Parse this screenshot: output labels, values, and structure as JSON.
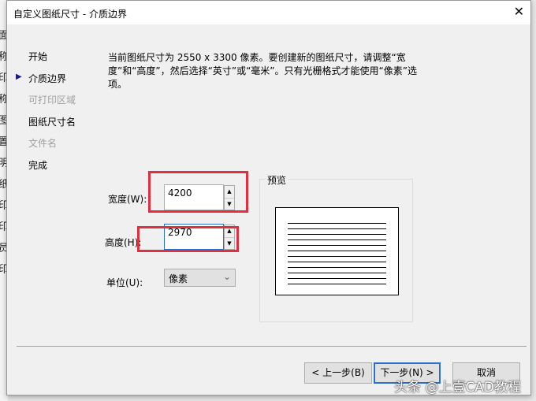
{
  "background_fragments": [
    "面",
    "称",
    "印",
    "称",
    "图",
    "置",
    "明",
    "纸",
    "印",
    "印",
    "员",
    "印"
  ],
  "dialog": {
    "title": "自定义图纸尺寸 - 介质边界",
    "close_icon": "close-icon",
    "nav": [
      {
        "label": "开始",
        "enabled": true
      },
      {
        "label": "介质边界",
        "enabled": true,
        "current": true
      },
      {
        "label": "可打印区域",
        "enabled": false
      },
      {
        "label": "图纸尺寸名",
        "enabled": true
      },
      {
        "label": "文件名",
        "enabled": false
      },
      {
        "label": "完成",
        "enabled": true
      }
    ],
    "description": "当前图纸尺寸为 2550 x 3300 像素。要创建新的图纸尺寸，请调整“宽度”和“高度”，然后选择“英寸”或“毫米”。只有光栅格式才能使用“像素”选项。",
    "width_label": "宽度(W):",
    "width_value": "4200",
    "height_label": "高度(H):",
    "height_value": "2970",
    "unit_label": "单位(U):",
    "unit_value": "像素",
    "preview_label": "预览",
    "buttons": {
      "back": "< 上一步(B)",
      "next": "下一步(N) >",
      "cancel": "取消"
    },
    "highlight_color": "#e03040"
  },
  "watermark": "头条 @上壹CAD教程"
}
